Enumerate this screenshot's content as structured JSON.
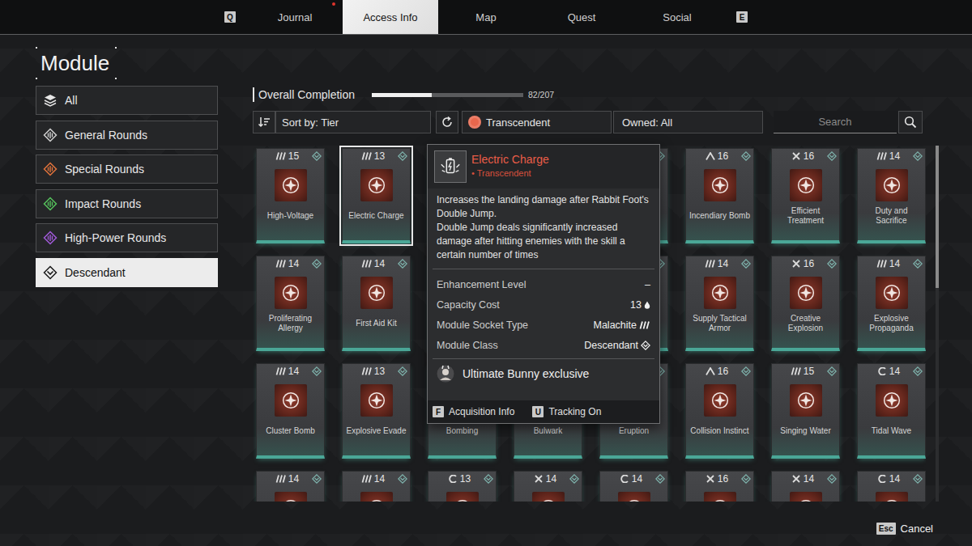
{
  "nav": {
    "keys": {
      "left": "Q",
      "right": "E"
    },
    "tabs": [
      {
        "label": "Journal",
        "selected": false,
        "notification": true
      },
      {
        "label": "Access Info",
        "selected": true,
        "notification": false
      },
      {
        "label": "Map",
        "selected": false,
        "notification": false
      },
      {
        "label": "Quest",
        "selected": false,
        "notification": false
      },
      {
        "label": "Social",
        "selected": false,
        "notification": false
      }
    ]
  },
  "page_title": "Module",
  "sidebar": {
    "items": [
      {
        "label": "All",
        "icon": "layers",
        "color": "#e6e6e6",
        "selected": false
      },
      {
        "label": "General Rounds",
        "icon": "round",
        "color": "#d0d0d0",
        "selected": false
      },
      {
        "label": "Special Rounds",
        "icon": "round",
        "color": "#e0733c",
        "selected": false
      },
      {
        "label": "Impact Rounds",
        "icon": "round",
        "color": "#55c05c",
        "selected": false
      },
      {
        "label": "High-Power Rounds",
        "icon": "round",
        "color": "#a05ad8",
        "selected": false
      },
      {
        "label": "Descendant",
        "icon": "descendant",
        "color": "#1a1a1a",
        "selected": true
      }
    ]
  },
  "completion": {
    "label": "Overall Completion",
    "level": 0.396,
    "reading": "82/207"
  },
  "filters": {
    "sort": "Sort by: Tier",
    "tier": {
      "label": "Transcendent",
      "color": "#e8674d"
    },
    "owned": "Owned: All",
    "search": {
      "placeholder": "Search"
    }
  },
  "modules": [
    {
      "name": "High-Voltage",
      "capacity": "15",
      "socket": "malachite",
      "selected": false
    },
    {
      "name": "Electric Charge",
      "capacity": "13",
      "socket": "malachite",
      "selected": true
    },
    {
      "name": "",
      "capacity": "",
      "socket": "none",
      "selected": false
    },
    {
      "name": "",
      "capacity": "",
      "socket": "none",
      "selected": false
    },
    {
      "name": "",
      "capacity": "",
      "socket": "none",
      "selected": false
    },
    {
      "name": "Incendiary Bomb",
      "capacity": "16",
      "socket": "cerulean",
      "selected": false
    },
    {
      "name": "Efficient Treatment",
      "capacity": "16",
      "socket": "xantic",
      "selected": false
    },
    {
      "name": "Duty and Sacrifice",
      "capacity": "14",
      "socket": "malachite",
      "selected": false
    },
    {
      "name": "Proliferating Allergy",
      "capacity": "14",
      "socket": "malachite",
      "selected": false
    },
    {
      "name": "First Aid Kit",
      "capacity": "14",
      "socket": "malachite",
      "selected": false
    },
    {
      "name": "",
      "capacity": "",
      "socket": "none",
      "selected": false
    },
    {
      "name": "",
      "capacity": "",
      "socket": "none",
      "selected": false
    },
    {
      "name": "",
      "capacity": "",
      "socket": "none",
      "selected": false
    },
    {
      "name": "Supply Tactical Armor",
      "capacity": "14",
      "socket": "malachite",
      "selected": false
    },
    {
      "name": "Creative Explosion",
      "capacity": "16",
      "socket": "xantic",
      "selected": false
    },
    {
      "name": "Explosive Propaganda",
      "capacity": "14",
      "socket": "malachite",
      "selected": false
    },
    {
      "name": "Cluster Bomb",
      "capacity": "14",
      "socket": "malachite",
      "selected": false
    },
    {
      "name": "Explosive Evade",
      "capacity": "13",
      "socket": "malachite",
      "selected": false
    },
    {
      "name": "Bombing",
      "capacity": "",
      "socket": "none",
      "selected": false
    },
    {
      "name": "Bulwark",
      "capacity": "",
      "socket": "none",
      "selected": false
    },
    {
      "name": "Eruption",
      "capacity": "",
      "socket": "none",
      "selected": false
    },
    {
      "name": "Collision Instinct",
      "capacity": "16",
      "socket": "cerulean",
      "selected": false
    },
    {
      "name": "Singing Water",
      "capacity": "15",
      "socket": "malachite",
      "selected": false
    },
    {
      "name": "Tidal Wave",
      "capacity": "14",
      "socket": "almandine",
      "selected": false
    },
    {
      "name": "",
      "capacity": "14",
      "socket": "malachite",
      "selected": false
    },
    {
      "name": "",
      "capacity": "14",
      "socket": "malachite",
      "selected": false
    },
    {
      "name": "",
      "capacity": "13",
      "socket": "almandine",
      "selected": false
    },
    {
      "name": "",
      "capacity": "14",
      "socket": "xantic",
      "selected": false
    },
    {
      "name": "",
      "capacity": "14",
      "socket": "almandine",
      "selected": false
    },
    {
      "name": "",
      "capacity": "16",
      "socket": "xantic",
      "selected": false
    },
    {
      "name": "",
      "capacity": "14",
      "socket": "xantic",
      "selected": false
    },
    {
      "name": "",
      "capacity": "14",
      "socket": "almandine",
      "selected": false
    }
  ],
  "scrollbar": {
    "level": 0.4
  },
  "tooltip": {
    "name": "Electric Charge",
    "tier": "• Transcendent",
    "description": [
      "Increases the landing damage after Rabbit Foot's Double Jump.",
      "Double Jump deals significantly increased damage after hitting enemies with the skill a certain number of times"
    ],
    "stats": [
      {
        "label": "Enhancement Level",
        "value": "–",
        "icon": "none"
      },
      {
        "label": "Capacity Cost",
        "value": "13",
        "icon": "drop"
      },
      {
        "label": "Module Socket Type",
        "value": "Malachite",
        "icon": "malachite"
      },
      {
        "label": "Module Class",
        "value": "Descendant",
        "icon": "descendant"
      }
    ],
    "exclusive": "Ultimate Bunny exclusive",
    "actions": [
      {
        "key": "F",
        "label": "Acquisition Info"
      },
      {
        "key": "U",
        "label": "Tracking On"
      }
    ]
  },
  "footer": {
    "key": "Esc",
    "label": "Cancel"
  }
}
